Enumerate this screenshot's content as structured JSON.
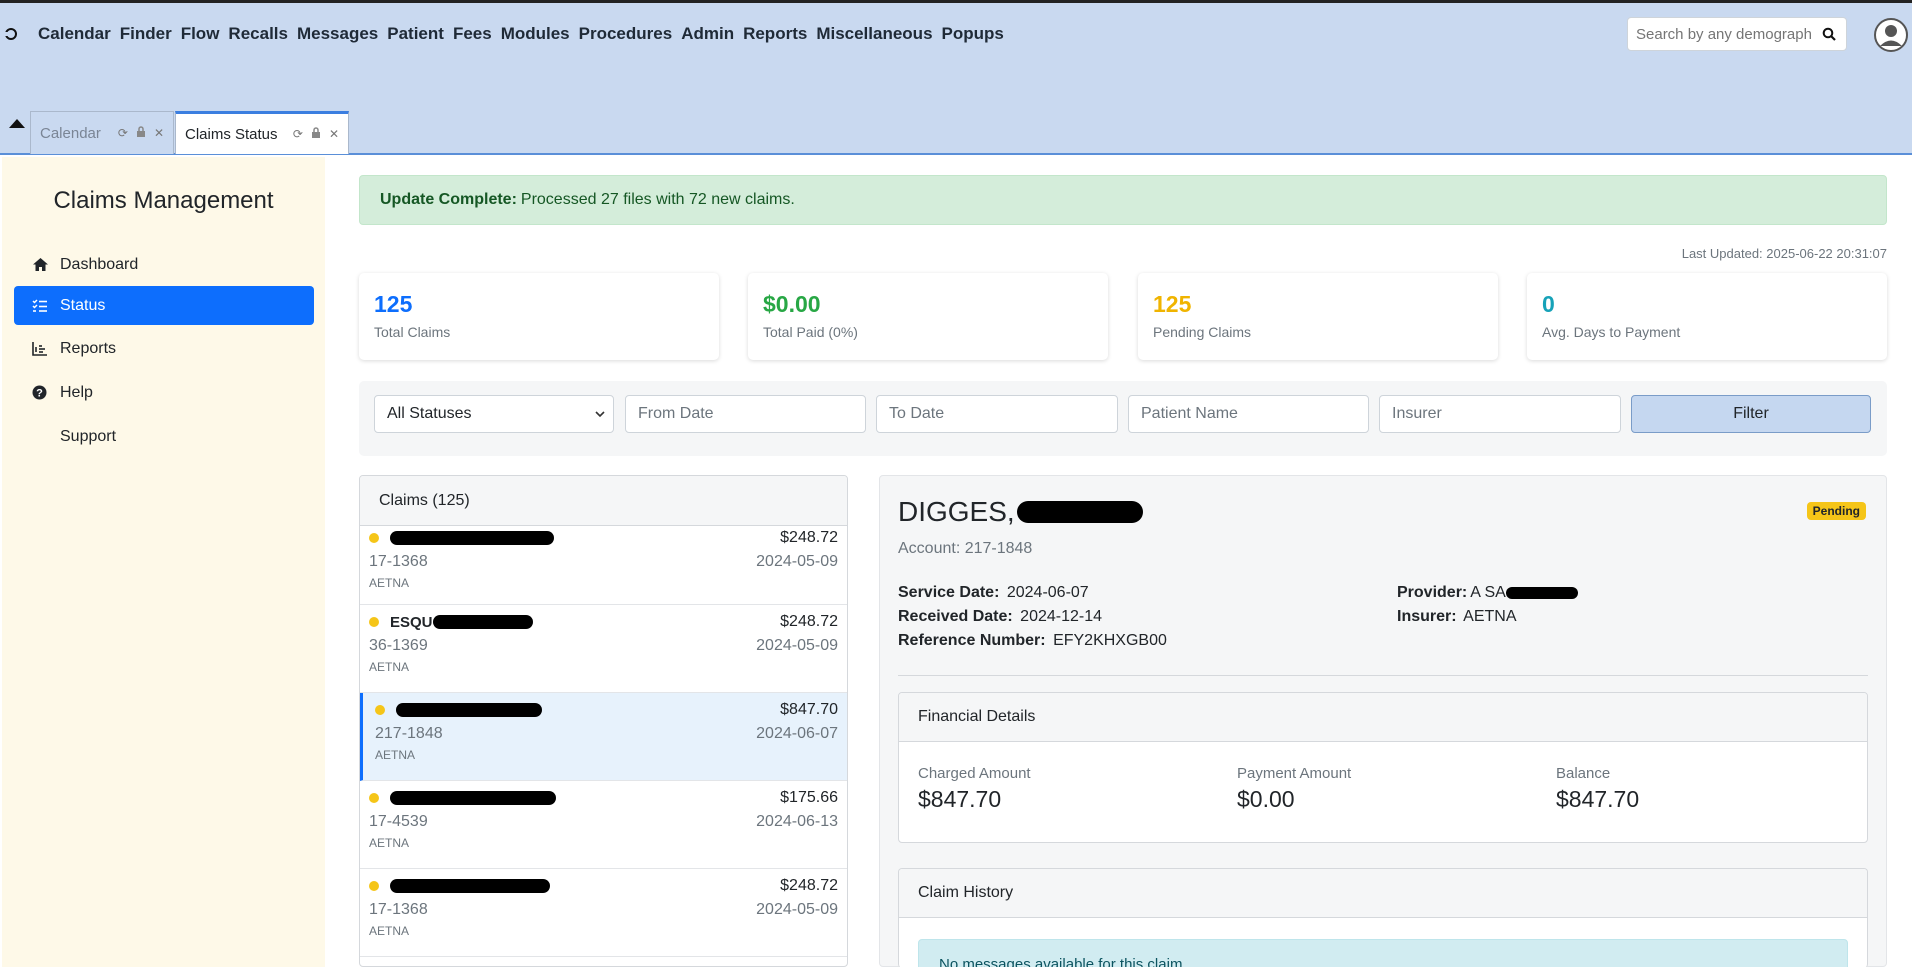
{
  "topbar": {
    "menu": [
      "Calendar",
      "Finder",
      "Flow",
      "Recalls",
      "Messages",
      "Patient",
      "Fees",
      "Modules",
      "Procedures",
      "Admin",
      "Reports",
      "Miscellaneous",
      "Popups"
    ],
    "search_placeholder": "Search by any demographics"
  },
  "tabs": [
    {
      "label": "Calendar",
      "active": false
    },
    {
      "label": "Claims Status",
      "active": true
    }
  ],
  "sidebar": {
    "title": "Claims Management",
    "items": [
      {
        "label": "Dashboard",
        "icon": "home-icon",
        "active": false
      },
      {
        "label": "Status",
        "icon": "list-check-icon",
        "active": true
      },
      {
        "label": "Reports",
        "icon": "chart-icon",
        "active": false
      },
      {
        "label": "Help",
        "icon": "help-icon",
        "active": false
      },
      {
        "label": "Support",
        "icon": "",
        "active": false
      }
    ]
  },
  "alert": {
    "strong": "Update Complete:",
    "text": "Processed 27 files with 72 new claims."
  },
  "last_updated": "Last Updated: 2025-06-22 20:31:07",
  "stats": [
    {
      "value": "125",
      "label": "Total Claims",
      "color": "#0d6efd"
    },
    {
      "value": "$0.00",
      "label": "Total Paid (0%)",
      "color": "#28a745"
    },
    {
      "value": "125",
      "label": "Pending Claims",
      "color": "#f0b400"
    },
    {
      "value": "0",
      "label": "Avg. Days to Payment",
      "color": "#17a2b8"
    }
  ],
  "filters": {
    "status_selected": "All Statuses",
    "from_date_placeholder": "From Date",
    "to_date_placeholder": "To Date",
    "patient_placeholder": "Patient Name",
    "insurer_placeholder": "Insurer",
    "filter_button": "Filter"
  },
  "claims_list": {
    "header": "Claims (125)",
    "items": [
      {
        "name_visible": "",
        "amount": "$248.72",
        "account": "17-1368",
        "date": "2024-05-09",
        "insurer": "AETNA",
        "selected": false
      },
      {
        "name_visible": "ESQU",
        "amount": "$248.72",
        "account": "36-1369",
        "date": "2024-05-09",
        "insurer": "AETNA",
        "selected": false
      },
      {
        "name_visible": "",
        "amount": "$847.70",
        "account": "217-1848",
        "date": "2024-06-07",
        "insurer": "AETNA",
        "selected": true
      },
      {
        "name_visible": "",
        "amount": "$175.66",
        "account": "17-4539",
        "date": "2024-06-13",
        "insurer": "AETNA",
        "selected": false
      },
      {
        "name_visible": "",
        "amount": "$248.72",
        "account": "17-1368",
        "date": "2024-05-09",
        "insurer": "AETNA",
        "selected": false
      }
    ]
  },
  "detail": {
    "name": "DIGGES,",
    "account": "Account: 217-1848",
    "status": "Pending",
    "service_date_label": "Service Date:",
    "service_date": "2024-06-07",
    "received_date_label": "Received Date:",
    "received_date": "2024-12-14",
    "reference_label": "Reference Number:",
    "reference": "EFY2KHXGB00",
    "provider_label": "Provider:",
    "provider": "A SA",
    "insurer_label": "Insurer:",
    "insurer": "AETNA",
    "financial": {
      "header": "Financial Details",
      "charged_label": "Charged Amount",
      "charged": "$847.70",
      "payment_label": "Payment Amount",
      "payment": "$0.00",
      "balance_label": "Balance",
      "balance": "$847.70"
    },
    "history": {
      "header": "Claim History",
      "message": "No messages available for this claim."
    }
  }
}
